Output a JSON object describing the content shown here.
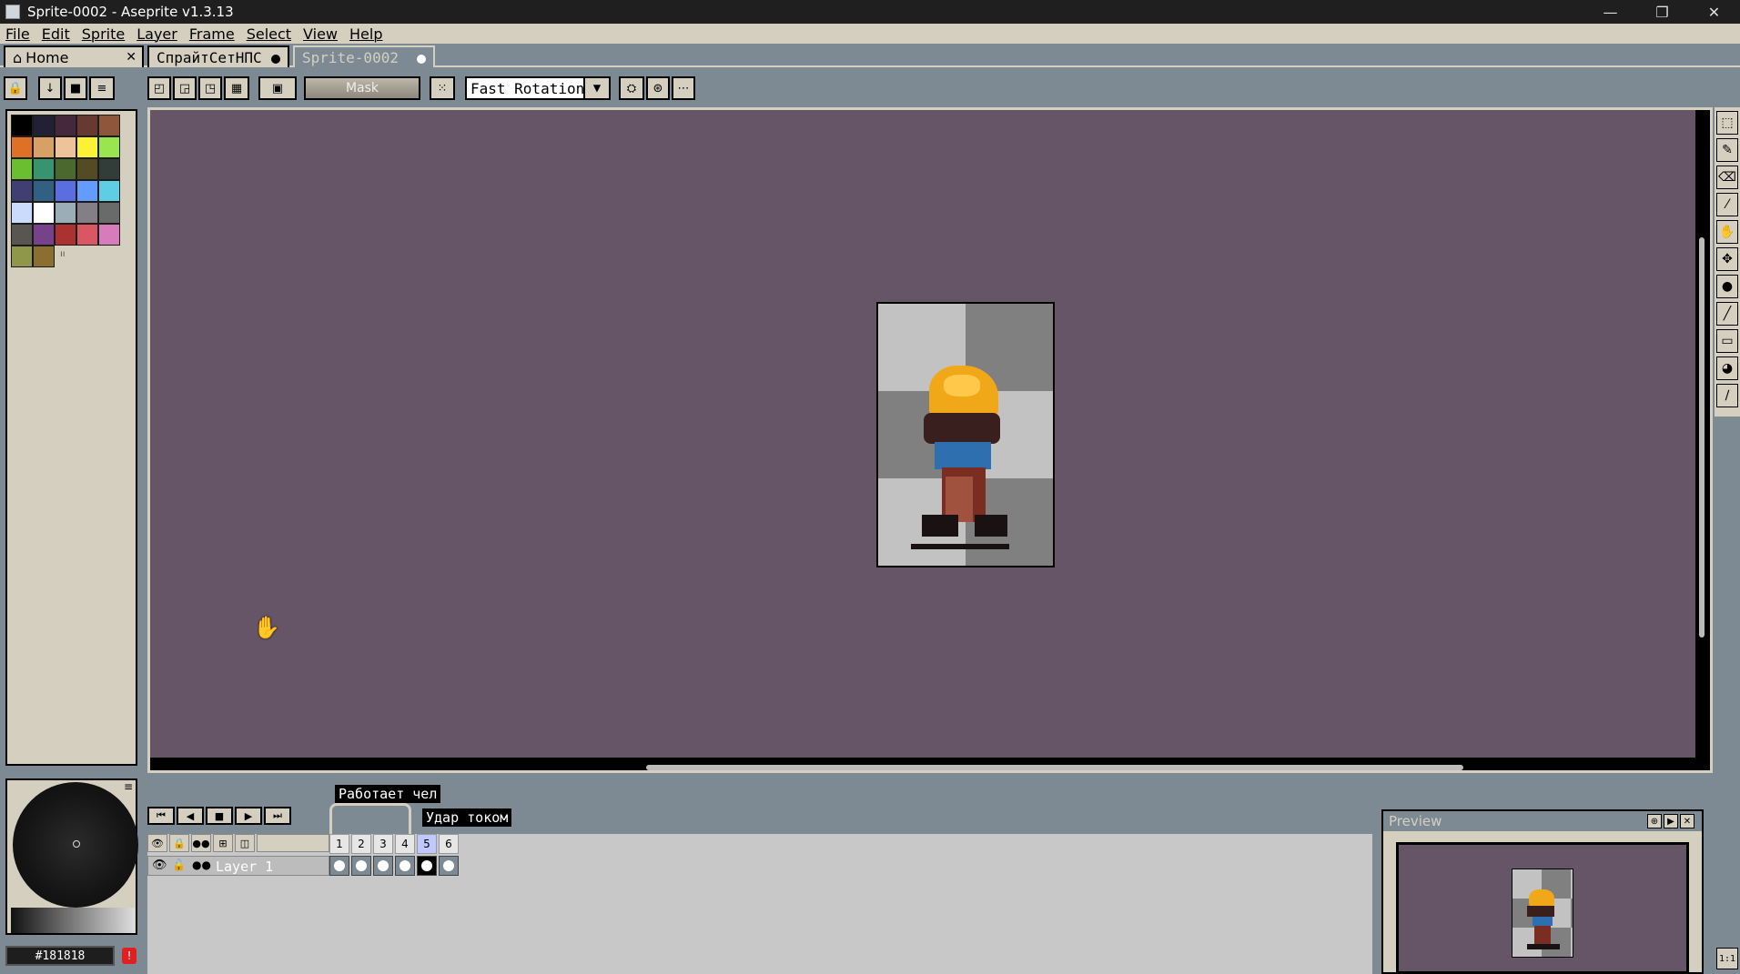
{
  "window": {
    "title": "Sprite-0002 - Aseprite v1.3.13",
    "controls": [
      "—",
      "❐",
      "✕"
    ]
  },
  "menu": [
    "File",
    "Edit",
    "Sprite",
    "Layer",
    "Frame",
    "Select",
    "View",
    "Help"
  ],
  "tabs": [
    {
      "label": "Home",
      "icon": "home-icon"
    },
    {
      "label": "СпрайтСетНПС"
    },
    {
      "label": "Sprite-0002"
    }
  ],
  "toolbar": {
    "mask_label": "Mask",
    "rotation_algorithm": "Fast Rotation"
  },
  "palette": {
    "colors": [
      "#000000",
      "#222034",
      "#45283c",
      "#663931",
      "#8f563b",
      "#df7126",
      "#d9a066",
      "#eec39a",
      "#fbf236",
      "#99e550",
      "#6abe30",
      "#37946e",
      "#4b692f",
      "#524b24",
      "#323c39",
      "#3f3f74",
      "#306082",
      "#5b6ee1",
      "#639bff",
      "#5fcde4",
      "#cbdbfc",
      "#ffffff",
      "#9badb7",
      "#847e87",
      "#696a6a",
      "#595652",
      "#76428a",
      "#ac3232",
      "#d95763",
      "#d77bba",
      "#8f974a",
      "#8a6f30"
    ]
  },
  "color": {
    "hex": "#181818"
  },
  "timeline": {
    "tags": [
      "Работает чел",
      "Удар током"
    ],
    "layer_name": "Layer 1",
    "frames": [
      "1",
      "2",
      "3",
      "4",
      "5",
      "6"
    ],
    "current_frame": "5"
  },
  "preview": {
    "title": "Preview",
    "zoom_label": "1:1"
  },
  "colors": {
    "canvas_bg": "#665566",
    "ui_face": "#d5cfc0",
    "ui_bg": "#7d8a94"
  }
}
